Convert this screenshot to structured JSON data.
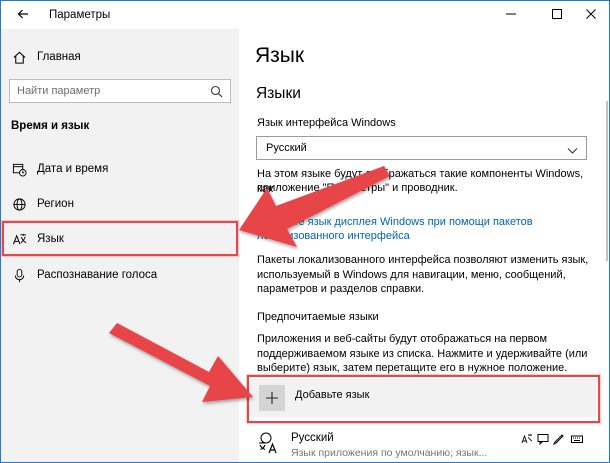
{
  "window": {
    "title": "Параметры"
  },
  "sidebar": {
    "home_label": "Главная",
    "search_placeholder": "Найти параметр",
    "section_title": "Время и язык",
    "items": [
      {
        "label": "Дата и время",
        "icon": "calendar-clock-icon"
      },
      {
        "label": "Регион",
        "icon": "globe-icon"
      },
      {
        "label": "Язык",
        "icon": "language-icon"
      },
      {
        "label": "Распознавание голоса",
        "icon": "microphone-icon"
      }
    ]
  },
  "content": {
    "page_title": "Язык",
    "languages_heading": "Языки",
    "ui_language_label": "Язык интерфейса Windows",
    "ui_language_value": "Русский",
    "ui_language_desc_1": "На этом языке будут отображаться такие компоненты Windows, как",
    "ui_language_desc_2": "приложение \"Параметры\" и проводник.",
    "link_1": "Добавьте язык дисплея Windows при помощи пакетов",
    "link_2": "локализованного интерфейса",
    "packs_desc": "Пакеты локализованного интерфейса позволяют изменить язык, используемый в Windows для навигации, меню, сообщений, параметров и разделов справки.",
    "preferred_label": "Предпочитаемые языки",
    "preferred_desc": "Приложения и веб-сайты будут отображаться на первом поддерживаемом языке из списка. Нажмите и удерживайте (или выберите) язык, затем перетащите его в нужное положение.",
    "add_language": "Добавьте язык",
    "installed_language": {
      "name": "Русский",
      "subtitle": "Язык приложения по умолчанию; язык..."
    }
  },
  "colors": {
    "accent": "#0063b1",
    "highlight": "#e8454a",
    "sidebar_bg": "#f2f2f2"
  }
}
